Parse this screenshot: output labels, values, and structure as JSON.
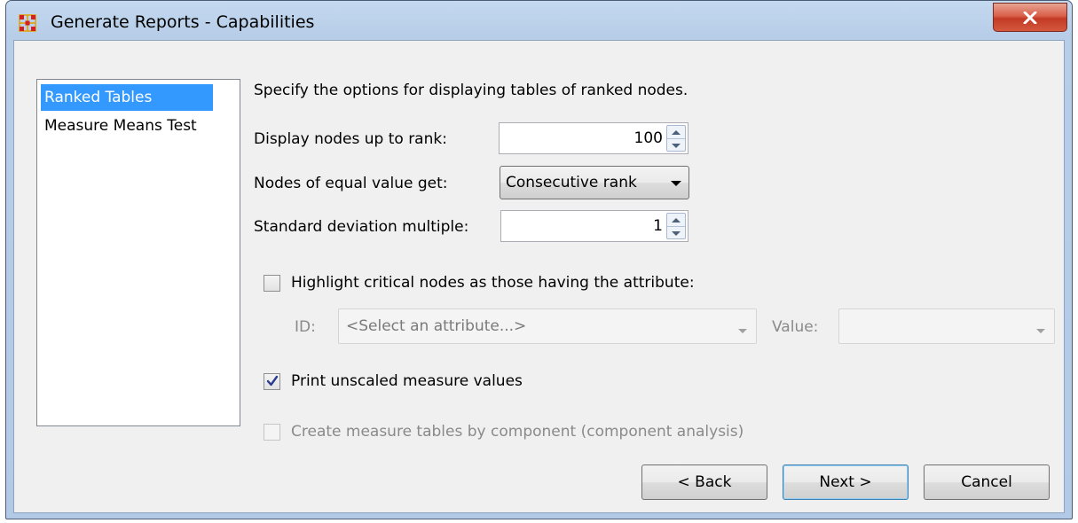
{
  "window": {
    "title": "Generate Reports - Capabilities",
    "close_label": "x"
  },
  "sidebar": {
    "items": [
      {
        "label": "Ranked Tables",
        "selected": true
      },
      {
        "label": "Measure Means Test",
        "selected": false
      }
    ]
  },
  "panel": {
    "description": "Specify the options for displaying tables of ranked nodes.",
    "rank_label": "Display nodes up to rank:",
    "rank_value": "100",
    "equal_label": "Nodes of equal value get:",
    "equal_value": "Consecutive rank",
    "stddev_label": "Standard deviation multiple:",
    "stddev_value": "1",
    "highlight_label": "Highlight critical nodes as those having the attribute:",
    "highlight_checked": false,
    "id_label": "ID:",
    "id_placeholder": "<Select an attribute...>",
    "value_label": "Value:",
    "value_value": "",
    "print_label": "Print unscaled measure values",
    "print_checked": true,
    "component_label": "Create measure tables by component (component analysis)",
    "component_checked": false
  },
  "buttons": {
    "back": "< Back",
    "next": "Next >",
    "cancel": "Cancel"
  },
  "colors": {
    "selection": "#3399ff",
    "close_button": "#c9452e",
    "title_bar": "#b9cfe9"
  },
  "icons": {
    "app": "network-grid-icon",
    "close": "close-icon",
    "check": "checkmark-icon"
  }
}
